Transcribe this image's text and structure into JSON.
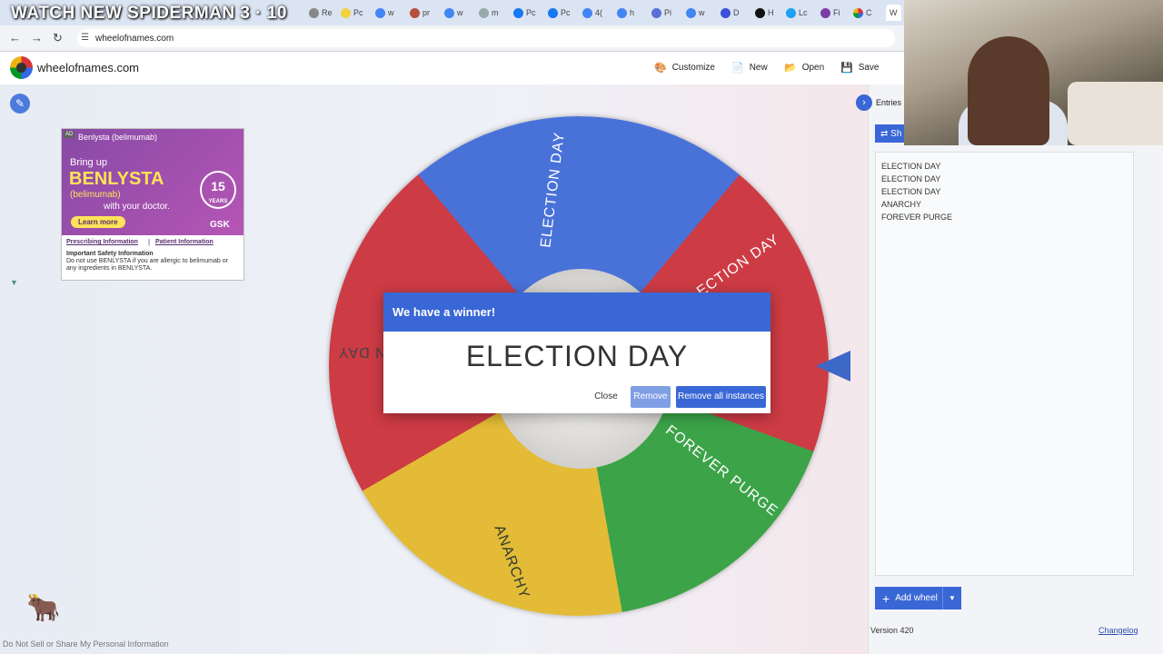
{
  "overlay_title": "WATCH NEW SPIDERMAN 3 · 10",
  "browser": {
    "tabs": [
      "Re",
      "Pc",
      "w",
      "pr",
      "w",
      "m",
      "Pc",
      "Pc",
      "4(",
      "h",
      "Pi",
      "w",
      "D",
      "H",
      "Lc",
      "Fi",
      "C",
      "W"
    ],
    "url": "wheelofnames.com"
  },
  "header": {
    "site_name": "wheelofnames.com",
    "customize": "Customize",
    "new": "New",
    "open": "Open",
    "save": "Save"
  },
  "ad": {
    "badge": "AD",
    "brand": "Benlysta (belimumab)",
    "bring_up": "Bring up",
    "name": "BENLYSTA",
    "generic": "(belimumab)",
    "with_doctor": "with your doctor.",
    "learn_more": "Learn more",
    "years_num": "15",
    "years_label": "YEARS",
    "company": "GSK",
    "prescribing": "Prescribing Information",
    "patient": "Patient Information",
    "safety_title": "Important Safety Information",
    "safety_text": "Do not use BENLYSTA if you are allergic to belimumab or any ingredients in BENLYSTA."
  },
  "wheel": {
    "labels": [
      "ELECTION DAY",
      "ELECTION DAY",
      "N DAY",
      "FOREVER PURGE",
      "ANARCHY"
    ],
    "colors": [
      "#c92b35",
      "#3a67d6",
      "#c92b35",
      "#2c9c3a",
      "#e1b625"
    ]
  },
  "dialog": {
    "title": "We have a winner!",
    "winner": "ELECTION DAY",
    "close": "Close",
    "remove": "Remove",
    "remove_all": "Remove all instances"
  },
  "sidebar": {
    "tab": "Entries",
    "shuffle": "Sh",
    "entries": [
      "ELECTION DAY",
      "ELECTION DAY",
      "ELECTION DAY",
      "ANARCHY",
      "FOREVER PURGE"
    ],
    "add_wheel": "Add wheel",
    "version": "Version 420",
    "changelog": "Changelog"
  },
  "footer": {
    "do_not_sell": "Do Not Sell or Share My Personal Information"
  }
}
